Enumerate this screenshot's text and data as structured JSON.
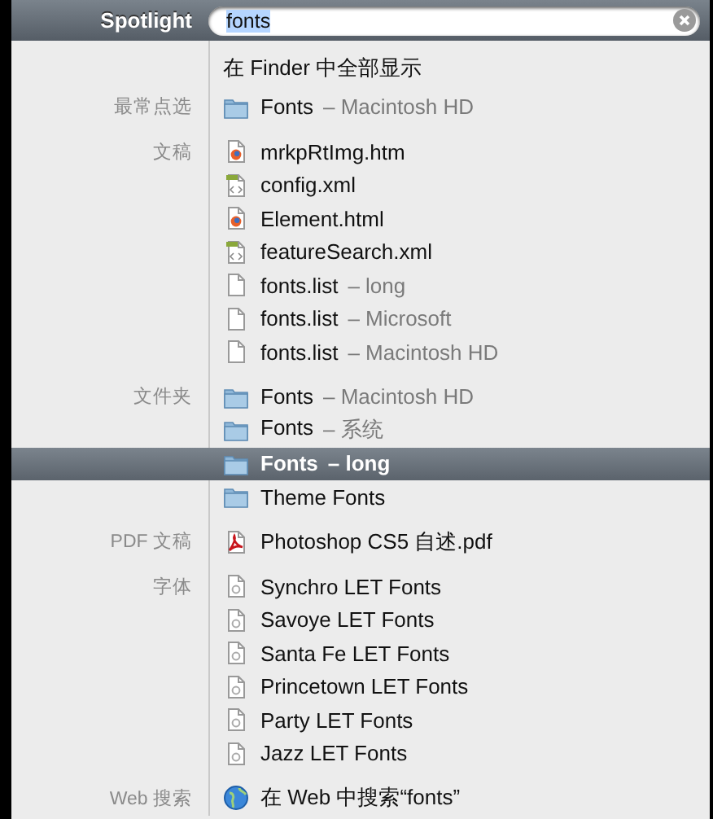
{
  "header": {
    "title": "Spotlight",
    "search": {
      "value": "fonts",
      "text_selected": true
    }
  },
  "show_all": "在 Finder 中全部显示",
  "groups": [
    {
      "label": "最常点选",
      "items": [
        {
          "kind": "folder",
          "name": "Fonts",
          "detail": "– Macintosh HD",
          "selected": false
        }
      ]
    },
    {
      "label": "文稿",
      "items": [
        {
          "kind": "html",
          "name": "mrkpRtImg.htm",
          "selected": false
        },
        {
          "kind": "xml",
          "name": "config.xml",
          "selected": false
        },
        {
          "kind": "html",
          "name": "Element.html",
          "selected": false
        },
        {
          "kind": "xml",
          "name": "featureSearch.xml",
          "selected": false
        },
        {
          "kind": "doc",
          "name": "fonts.list",
          "detail": "– long",
          "selected": false
        },
        {
          "kind": "doc",
          "name": "fonts.list",
          "detail": "– Microsoft",
          "selected": false
        },
        {
          "kind": "doc",
          "name": "fonts.list",
          "detail": "– Macintosh HD",
          "selected": false
        }
      ]
    },
    {
      "label": "文件夹",
      "items": [
        {
          "kind": "folder",
          "name": "Fonts",
          "detail": "– Macintosh HD",
          "selected": false
        },
        {
          "kind": "folder",
          "name": "Fonts",
          "detail": "– 系统",
          "selected": false
        },
        {
          "kind": "folder",
          "name": "Fonts",
          "detail": "– long",
          "selected": true
        },
        {
          "kind": "folder",
          "name": "Theme Fonts",
          "selected": false
        }
      ]
    },
    {
      "label": "PDF 文稿",
      "items": [
        {
          "kind": "pdf",
          "name": "Photoshop CS5 自述.pdf",
          "selected": false
        }
      ]
    },
    {
      "label": "字体",
      "items": [
        {
          "kind": "font",
          "name": "Synchro LET Fonts",
          "selected": false
        },
        {
          "kind": "font",
          "name": "Savoye LET Fonts",
          "selected": false
        },
        {
          "kind": "font",
          "name": "Santa Fe LET Fonts",
          "selected": false
        },
        {
          "kind": "font",
          "name": "Princetown LET Fonts",
          "selected": false
        },
        {
          "kind": "font",
          "name": "Party LET Fonts",
          "selected": false
        },
        {
          "kind": "font",
          "name": "Jazz LET Fonts",
          "selected": false
        }
      ]
    },
    {
      "label": "Web 搜索",
      "items": [
        {
          "kind": "web",
          "name": "在 Web 中搜索“fonts”",
          "selected": false
        }
      ]
    }
  ]
}
